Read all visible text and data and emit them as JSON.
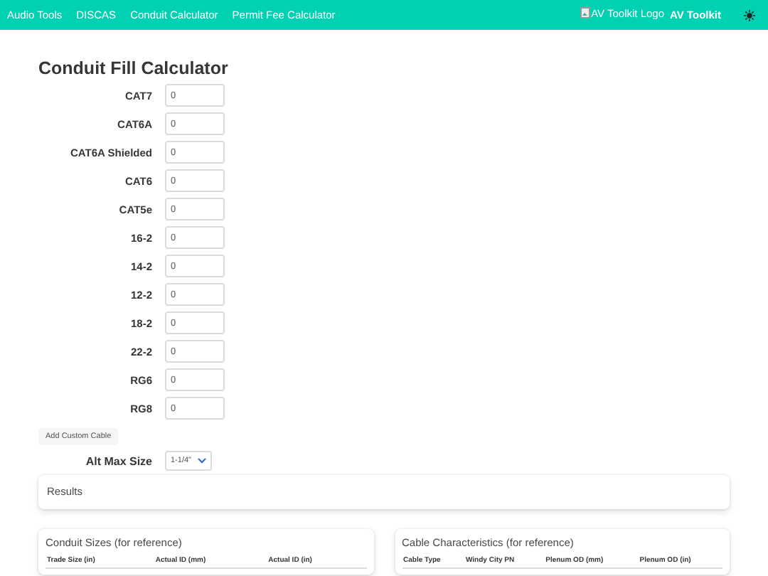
{
  "navbar": {
    "links": [
      "Audio Tools",
      "DISCAS",
      "Conduit Calculator",
      "Permit Fee Calculator"
    ],
    "logo_alt": "AV Toolkit Logo",
    "brand": "AV Toolkit"
  },
  "title": "Conduit Fill Calculator",
  "cables": [
    {
      "label": "CAT7",
      "value": "0"
    },
    {
      "label": "CAT6A",
      "value": "0"
    },
    {
      "label": "CAT6A Shielded",
      "value": "0"
    },
    {
      "label": "CAT6",
      "value": "0"
    },
    {
      "label": "CAT5e",
      "value": "0"
    },
    {
      "label": "16-2",
      "value": "0"
    },
    {
      "label": "14-2",
      "value": "0"
    },
    {
      "label": "12-2",
      "value": "0"
    },
    {
      "label": "18-2",
      "value": "0"
    },
    {
      "label": "22-2",
      "value": "0"
    },
    {
      "label": "RG6",
      "value": "0"
    },
    {
      "label": "RG8",
      "value": "0"
    }
  ],
  "add_button": "Add Custom Cable",
  "alt_max_size": {
    "label": "Alt Max Size",
    "value": "1-1/4\""
  },
  "results": {
    "title": "Results"
  },
  "conduit_sizes": {
    "title": "Conduit Sizes (for reference)",
    "columns": [
      "Trade Size (in)",
      "Actual ID (mm)",
      "Actual ID (in)"
    ]
  },
  "cable_characteristics": {
    "title": "Cable Characteristics (for reference)",
    "columns": [
      "Cable Type",
      "Windy City PN",
      "Plenum OD (mm)",
      "Plenum OD (in)"
    ]
  }
}
